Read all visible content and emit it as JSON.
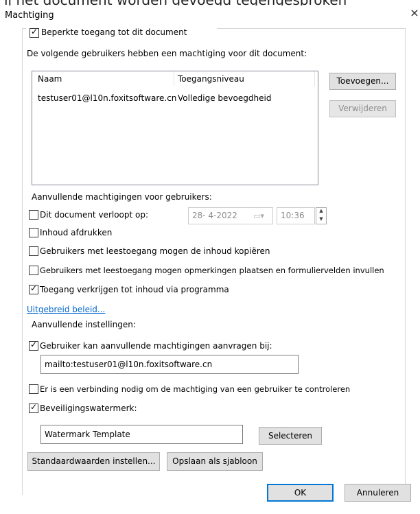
{
  "window": {
    "title": "Machtiging",
    "close_glyph": "×"
  },
  "restrict": {
    "label": "Beperkte toegang tot dit document",
    "checked": true
  },
  "users": {
    "intro": "De volgende gebruikers hebben een machtiging voor dit document:",
    "columns": [
      "Naam",
      "Toegangsniveau"
    ],
    "rows": [
      {
        "name": "testuser01@l10n.foxitsoftware.cn",
        "level": "Volledige bevoegdheid"
      }
    ],
    "add_button": "Toevoegen...",
    "remove_button": "Verwijderen"
  },
  "extra_permissions": {
    "heading": "Aanvullende machtigingen voor gebruikers:",
    "expires": {
      "label": "Dit document verloopt op:",
      "checked": false,
      "date": "28-  4-2022",
      "time": "10:36"
    },
    "items": [
      {
        "label": "Inhoud afdrukken",
        "checked": false
      },
      {
        "label": "Gebruikers met leestoegang mogen de inhoud kopiëren",
        "checked": false
      },
      {
        "label": "Gebruikers met leestoegang mogen opmerkingen plaatsen en formuliervelden invullen",
        "checked": false
      },
      {
        "label": "Toegang verkrijgen tot inhoud via programma",
        "checked": true
      }
    ],
    "advanced_link": "Uitgebreid beleid..."
  },
  "extra_settings": {
    "heading": "Aanvullende instellingen:",
    "request": {
      "label": "Gebruiker kan aanvullende machtigingen aanvragen bij:",
      "checked": true,
      "value": "mailto:testuser01@l10n.foxitsoftware.cn"
    },
    "connection": {
      "label": "Er is een verbinding nodig om de machtiging van een gebruiker te controleren",
      "checked": false
    },
    "watermark": {
      "label": "Beveiligingswatermerk:",
      "checked": true,
      "value": "Watermark Template",
      "select_button": "Selecteren"
    }
  },
  "footer": {
    "defaults_button": "Standaardwaarden instellen...",
    "save_template_button": "Opslaan als sjabloon",
    "ok_button": "OK",
    "cancel_button": "Annuleren"
  },
  "background_text": "ij het document worden gevoegd tegengesproken",
  "check_glyph": "✓"
}
